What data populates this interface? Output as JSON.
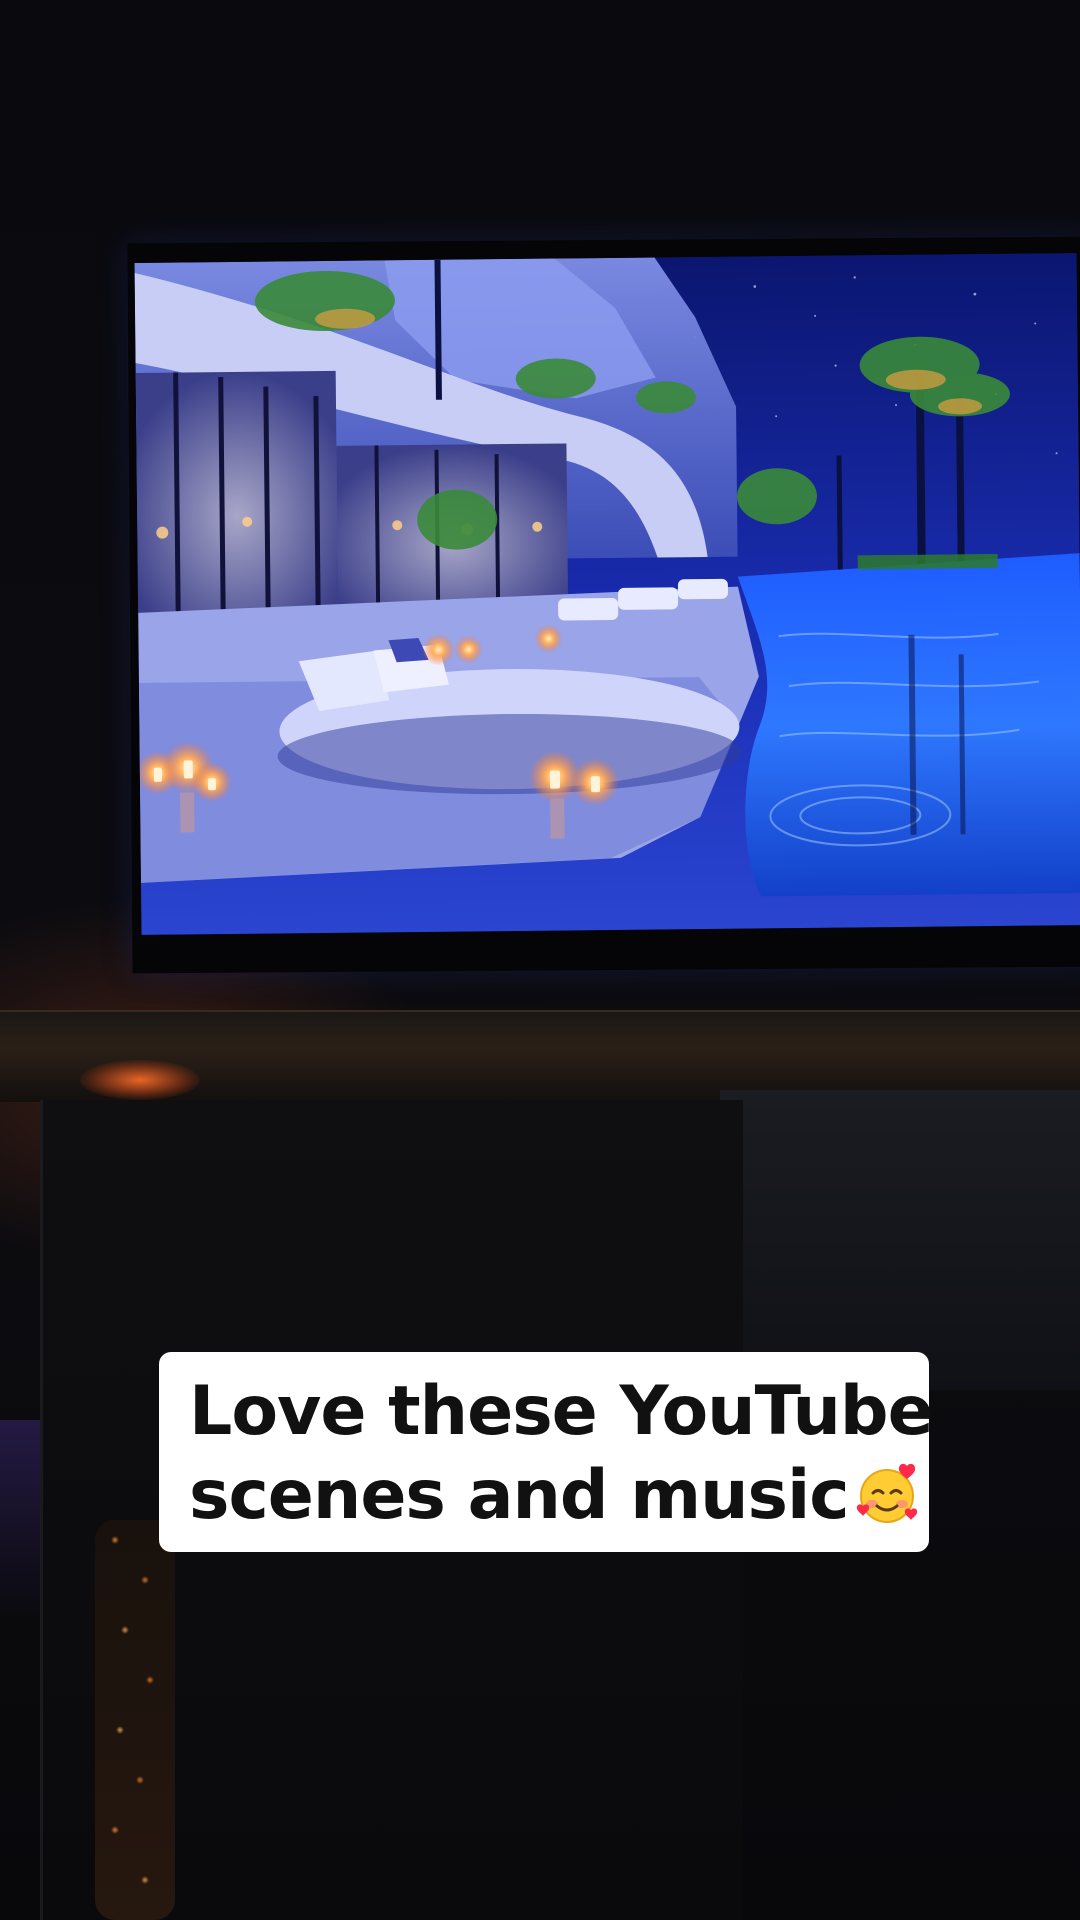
{
  "caption": {
    "line1": "Love these YouTube",
    "line2": "scenes and music",
    "emoji": "smiling-face-with-hearts-icon"
  },
  "colors": {
    "caption_background": "#ffffff",
    "caption_text": "#111111",
    "screen_blue": "#1a2fb5",
    "pool_blue": "#2a6cff",
    "candle_glow": "#ffb060"
  }
}
